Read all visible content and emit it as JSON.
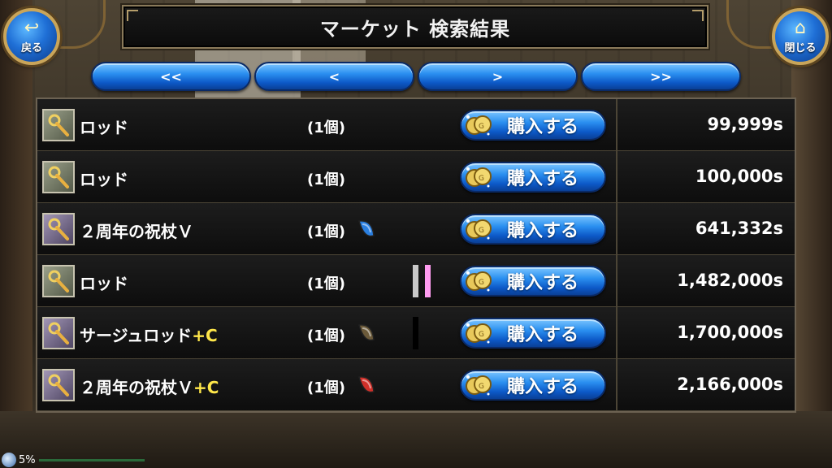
{
  "header": {
    "title": "マーケット 検索結果",
    "back_label": "戻る",
    "close_label": "閉じる"
  },
  "pager": [
    "<<",
    "<",
    ">",
    ">>"
  ],
  "buy_label": "購入する",
  "items": [
    {
      "name": "ロッド",
      "suffix": "",
      "qty": "(1個)",
      "gem": "none",
      "bars": [],
      "price": "99,999s",
      "icon": "staff-icon"
    },
    {
      "name": "ロッド",
      "suffix": "",
      "qty": "(1個)",
      "gem": "none",
      "bars": [],
      "price": "100,000s",
      "icon": "staff-icon"
    },
    {
      "name": "２周年の祝杖Ｖ",
      "suffix": "",
      "qty": "(1個)",
      "gem": "blue",
      "bars": [],
      "price": "641,332s",
      "icon": "staff-icon"
    },
    {
      "name": "ロッド",
      "suffix": "",
      "qty": "(1個)",
      "gem": "none",
      "bars": [
        "#c9c9c9",
        "#ff9cf0"
      ],
      "price": "1,482,000s",
      "icon": "staff-icon"
    },
    {
      "name": "サージュロッド",
      "suffix": "+C",
      "qty": "(1個)",
      "gem": "brown",
      "bars": [
        "#000000"
      ],
      "price": "1,700,000s",
      "icon": "staff-icon"
    },
    {
      "name": "２周年の祝杖Ｖ",
      "suffix": "+C",
      "qty": "(1個)",
      "gem": "red",
      "bars": [],
      "price": "2,166,000s",
      "icon": "staff-icon"
    }
  ],
  "footer": {
    "percent": "5%"
  },
  "colors": {
    "gem_blue": "#2a7fe0",
    "gem_brown": "#6b5a3a",
    "gem_red": "#d0302a",
    "suffix": "#ffe74a"
  }
}
